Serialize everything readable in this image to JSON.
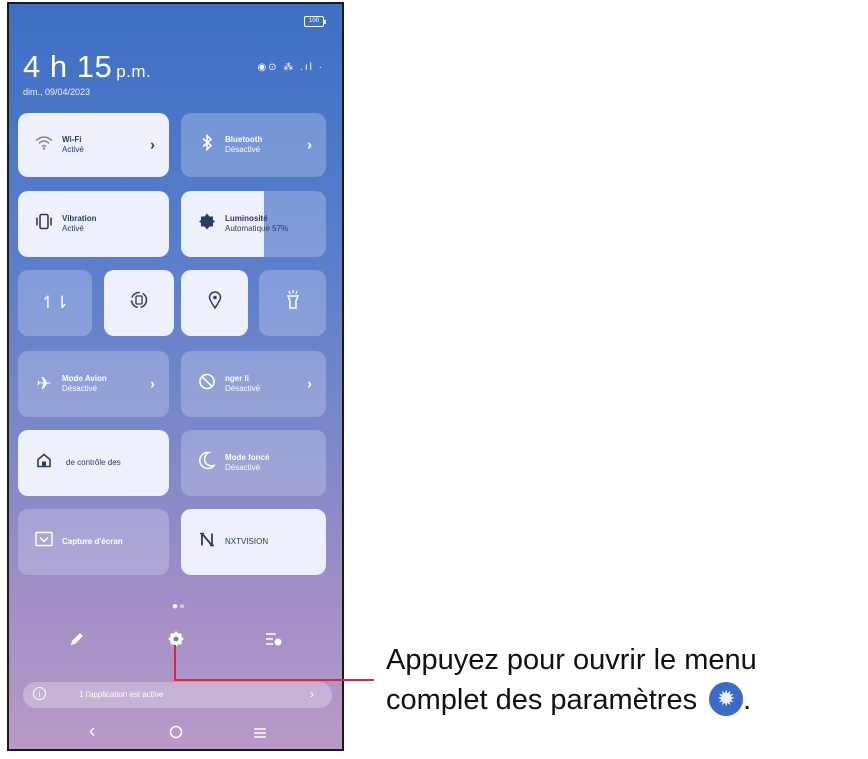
{
  "status": {
    "battery": "100"
  },
  "clock": {
    "time": "4 h 15",
    "suffix": "p.m.",
    "date": "dim., 09/04/2023",
    "icons": "◉⊙ ⁂ .ıl ·"
  },
  "tiles": {
    "wifi": {
      "title": "Wi-Fi",
      "status": "Activé",
      "icon": "wifi-icon"
    },
    "bluetooth": {
      "title": "Bluetooth",
      "status": "Désactivé",
      "icon": "bluetooth-icon"
    },
    "vibration": {
      "title": "Vibration",
      "status": "Activé",
      "icon": "vibration-icon"
    },
    "brightness": {
      "title": "Luminosité",
      "status": "Automatique 57%",
      "icon": "brightness-icon",
      "level": 0.57
    },
    "mobile_data": {
      "icon": "mobile-data-icon"
    },
    "auto_rotate": {
      "icon": "auto-rotate-icon"
    },
    "location": {
      "icon": "location-icon"
    },
    "flashlight": {
      "icon": "flashlight-icon"
    },
    "airplane": {
      "title": "Mode Avion",
      "status": "Désactivé",
      "icon": "airplane-icon"
    },
    "do_not_disturb": {
      "title": "nger   li",
      "status": "Désactivé",
      "icon": "do-not-disturb-icon"
    },
    "home_control": {
      "title": "de contrôle des",
      "icon": "home-icon"
    },
    "dark_mode": {
      "title": "Mode foncé",
      "status": "Désactivé",
      "icon": "moon-icon"
    },
    "screenshot": {
      "title": "Capture d'écran",
      "icon": "screenshot-icon"
    },
    "nxtvision": {
      "title": "NXTVISION",
      "icon": "nxtvision-icon"
    }
  },
  "bottom_bar": {
    "edit_icon": "pencil-icon",
    "settings_icon": "gear-icon",
    "reorder_icon": "edit-list-icon"
  },
  "banner": {
    "text": "1 l'application est active"
  },
  "nav": {
    "back": "back-icon",
    "home": "home-circle-icon",
    "recents": "recents-icon"
  },
  "callout": {
    "line1": "Appuyez pour ouvrir le menu",
    "line2": "complet des paramètres",
    "period": "."
  },
  "colors": {
    "tile_on": "#eef1fb",
    "accent_red": "#d7263d",
    "gear_badge": "#3c6bc7"
  }
}
